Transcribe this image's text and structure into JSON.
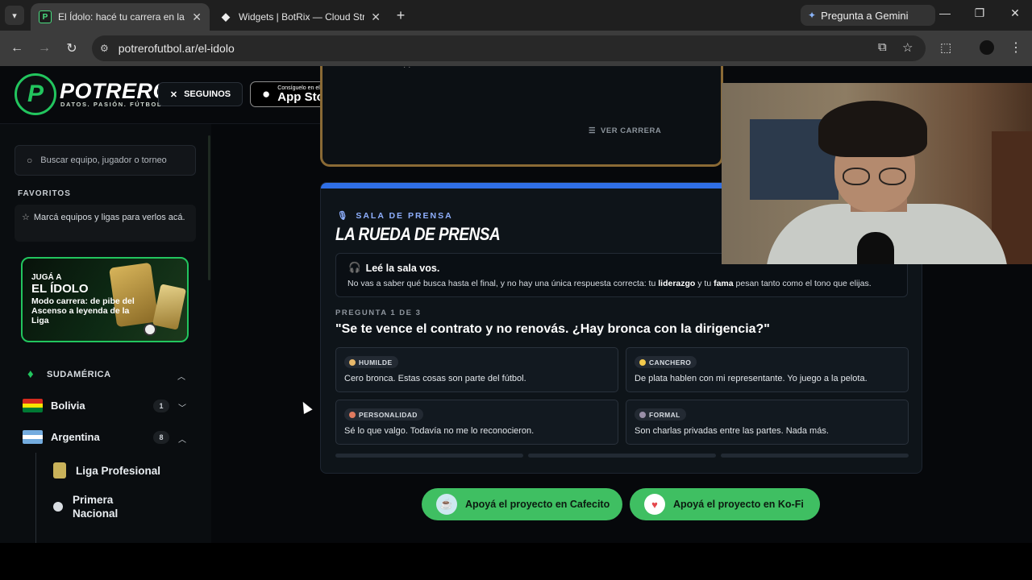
{
  "browser": {
    "tabs": [
      {
        "title": "El Ídolo: hacé tu carrera en la Liga",
        "favicon": "P",
        "active": true
      },
      {
        "title": "Widgets | BotRix — Cloud Streaming",
        "favicon": "◆",
        "active": false
      }
    ],
    "new_tab": "+",
    "gemini_label": "Pregunta a Gemini",
    "url": "potrerofutbol.ar/el-idolo",
    "icons": [
      "tab-search-icon",
      "back-icon",
      "forward-icon",
      "reload-icon",
      "site-info-icon",
      "install-app-icon",
      "bookmark-star-icon",
      "extensions-icon",
      "profile-avatar",
      "menu-kebab-icon",
      "minimize-icon",
      "maximize-icon",
      "close-window-icon"
    ]
  },
  "header": {
    "logo_letter": "P",
    "logo_name": "POTRERO",
    "logo_tagline": "DATOS. PASIÓN. FÚTBOL.",
    "follow_label": "SEGUINOS",
    "appstore_small": "Consíguelo en el",
    "appstore_big": "App Store"
  },
  "sidebar": {
    "search_placeholder": "Buscar equipo, jugador o torneo",
    "favorites_title": "FAVORITOS",
    "favorites_empty": "Marcá equipos y ligas para verlos acá.",
    "promo": {
      "line1": "JUGÁ A",
      "line2": "EL ÍDOLO",
      "line3": "Modo carrera: de pibe del Ascenso a leyenda de la Liga"
    },
    "region": "SUDAMÉRICA",
    "countries": [
      {
        "name": "Bolivia",
        "count": "1",
        "colors": [
          "#d52b1e",
          "#f9e300",
          "#007934"
        ]
      },
      {
        "name": "Argentina",
        "count": "8",
        "colors": [
          "#74acdf",
          "#ffffff",
          "#74acdf"
        ]
      }
    ],
    "leagues": [
      {
        "name": "Liga Profesional"
      },
      {
        "name": "Primera Nacional"
      }
    ]
  },
  "career": {
    "ver_carrera": "VER CARRERA"
  },
  "press": {
    "kicker": "SALA DE PRENSA",
    "title": "LA RUEDA DE PRENSA",
    "note_title": "Leé la sala vos.",
    "note_body_1": "No vas a saber qué busca hasta el final, y no hay una única respuesta correcta: tu ",
    "note_bold_1": "liderazgo",
    "note_body_2": " y tu ",
    "note_bold_2": "fama",
    "note_body_3": " pesan tanto como el tono que elijas.",
    "question_number": "PREGUNTA 1 DE 3",
    "question": "\"Se te vence el contrato y no renovás. ¿Hay bronca con la dirigencia?\"",
    "answers": [
      {
        "badge": "HUMILDE",
        "text": "Cero bronca. Estas cosas son parte del fútbol.",
        "color": "#e8b86a"
      },
      {
        "badge": "CANCHERO",
        "text": "De plata hablen con mi representante. Yo juego a la pelota.",
        "color": "#f2c94c"
      },
      {
        "badge": "PERSONALIDAD",
        "text": "Sé lo que valgo. Todavía no me lo reconocieron.",
        "color": "#e07a5f"
      },
      {
        "badge": "FORMAL",
        "text": "Son charlas privadas entre las partes. Nada más.",
        "color": "#9a8fa8"
      }
    ]
  },
  "support": {
    "cafecito": "Apoyá el proyecto en Cafecito",
    "kofi": "Apoyá el proyecto en Ko-Fi"
  },
  "colors": {
    "brand_green": "#22c55e",
    "press_accent": "#2f6fe6",
    "career_border": "#8a6a35"
  }
}
